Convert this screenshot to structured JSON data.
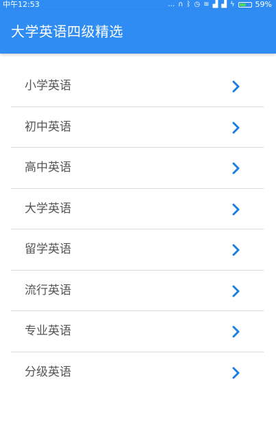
{
  "status_bar": {
    "time": "中午12:53",
    "icons": [
      "more-icon",
      "headset-icon",
      "bluetooth-icon",
      "alarm-icon",
      "wifi-icon",
      "signal-icon",
      "signal-icon",
      "charging-icon"
    ],
    "battery_percent": "59%",
    "battery_level": 0.59
  },
  "app_bar": {
    "title": "大学英语四级精选"
  },
  "list": {
    "items": [
      {
        "label": "小学英语"
      },
      {
        "label": "初中英语"
      },
      {
        "label": "高中英语"
      },
      {
        "label": "大学英语"
      },
      {
        "label": "留学英语"
      },
      {
        "label": "流行英语"
      },
      {
        "label": "专业英语"
      },
      {
        "label": "分级英语"
      }
    ]
  },
  "colors": {
    "primary": "#2f8cf3",
    "chevron": "#1a7fe0",
    "item_text": "#555555",
    "divider": "#dcdcdc"
  }
}
